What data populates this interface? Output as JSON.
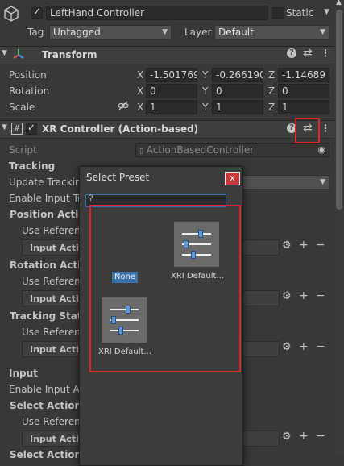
{
  "header": {
    "object_name": "LeftHand Controller",
    "static_label": "Static",
    "tag_label": "Tag",
    "tag_value": "Untagged",
    "layer_label": "Layer",
    "layer_value": "Default"
  },
  "transform": {
    "title": "Transform",
    "position_label": "Position",
    "rotation_label": "Rotation",
    "scale_label": "Scale",
    "axis_x": "X",
    "axis_y": "Y",
    "axis_z": "Z",
    "position": [
      "-1.501769",
      "-0.266190",
      "-1.14689"
    ],
    "rotation": [
      "0",
      "0",
      "0"
    ],
    "scale": [
      "1",
      "1",
      "1"
    ]
  },
  "xr": {
    "title": "XR Controller (Action-based)",
    "script_label": "Script",
    "script_value": "ActionBasedController",
    "tracking_label": "Tracking",
    "update_tracking_label": "Update Trackin",
    "update_tracking_value": "nder",
    "enable_input_tracking_label": "Enable Input Tra",
    "position_action_label": "Position Action",
    "rotation_action_label": "Rotation Action",
    "tracking_state_label": "Tracking State",
    "use_reference_label": "Use Referenc",
    "input_action_label": "Input Action",
    "input_label": "Input",
    "enable_input_actions_label": "Enable Input Ac",
    "select_action_label": "Select Action",
    "select_action_value_label": "Select Action V"
  },
  "popup": {
    "title": "Select Preset",
    "close": "x",
    "search_placeholder": "",
    "none_label": "None",
    "preset1_label": "XRI Default...",
    "preset2_label": "XRI Default..."
  },
  "colors": {
    "background": "#383838",
    "accent_blue": "#3a72b0",
    "highlight_red": "#e0242b"
  }
}
